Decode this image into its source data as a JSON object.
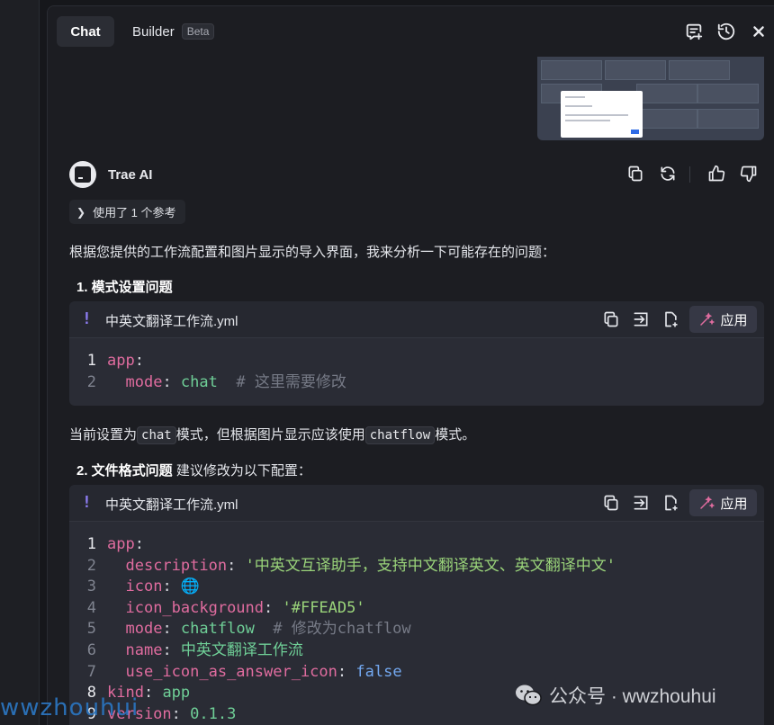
{
  "tabs": {
    "chat": "Chat",
    "builder": "Builder",
    "builder_badge": "Beta"
  },
  "message": {
    "sender": "Trae AI",
    "reference_chip": "使用了 1 个参考",
    "intro": "根据您提供的工作流配置和图片显示的导入界面，我来分析一下可能存在的问题：",
    "item1_title": "1. 模式设置问题",
    "note_prefix": "当前设置为",
    "note_code1": "chat",
    "note_middle": "模式，但根据图片显示应该使用",
    "note_code2": "chatflow",
    "note_suffix": "模式。",
    "item2_title": "2. 文件格式问题",
    "item2_text": " 建议修改为以下配置："
  },
  "code_blocks": [
    {
      "filename": "中英文翻译工作流.yml",
      "apply_label": "应用",
      "lines": [
        {
          "n": "1",
          "key": "app",
          "sep": ":",
          "value": "",
          "comment": ""
        },
        {
          "n": "2",
          "indent": "  ",
          "key": "mode",
          "sep": ": ",
          "value": "chat",
          "comment": "  # 这里需要修改"
        }
      ]
    },
    {
      "filename": "中英文翻译工作流.yml",
      "apply_label": "应用",
      "lines": [
        {
          "n": "1",
          "key": "app",
          "sep": ":",
          "value": ""
        },
        {
          "n": "2",
          "indent": "  ",
          "key": "description",
          "sep": ": ",
          "value": "'中英文互译助手，支持中文翻译英文、英文翻译中文'"
        },
        {
          "n": "3",
          "indent": "  ",
          "key": "icon",
          "sep": ": ",
          "value": "🌐"
        },
        {
          "n": "4",
          "indent": "  ",
          "key": "icon_background",
          "sep": ": ",
          "value": "'#FFEAD5'"
        },
        {
          "n": "5",
          "indent": "  ",
          "key": "mode",
          "sep": ": ",
          "value": "chatflow",
          "comment": "  # 修改为chatflow"
        },
        {
          "n": "6",
          "indent": "  ",
          "key": "name",
          "sep": ": ",
          "value": "中英文翻译工作流"
        },
        {
          "n": "7",
          "indent": "  ",
          "key": "use_icon_as_answer_icon",
          "sep": ": ",
          "value": "false"
        },
        {
          "n": "8",
          "key": "kind",
          "sep": ": ",
          "value": "app"
        },
        {
          "n": "9",
          "key": "version",
          "sep": ": ",
          "value": "0.1.3"
        }
      ]
    }
  ],
  "watermark": {
    "text": "公众号 · wwzhouhui",
    "left_text": "wwzhouhui"
  },
  "colors": {
    "yaml_key": "#e06c9f",
    "yaml_string": "#9ad47a",
    "yaml_value": "#6fcf97",
    "yaml_bool": "#73a8f0",
    "yaml_comment": "#767a86",
    "accent_bang": "#8c7cf0"
  }
}
